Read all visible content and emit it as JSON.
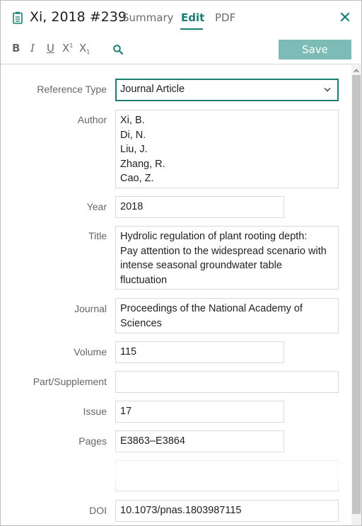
{
  "header": {
    "title": "Xi, 2018 #239",
    "icon": "clipboard-icon",
    "tabs": [
      {
        "label": "Summary",
        "active": false
      },
      {
        "label": "Edit",
        "active": true
      },
      {
        "label": "PDF",
        "active": false
      }
    ],
    "close_icon": "close-icon"
  },
  "toolbar": {
    "bold": "B",
    "italic": "I",
    "underline": "U",
    "superscript": "X",
    "superscript_mark": "1",
    "subscript": "X",
    "subscript_mark": "1",
    "search_icon": "search-icon",
    "save_label": "Save"
  },
  "colors": {
    "accent": "#177e74",
    "save_button": "#7dbcb6",
    "label_text": "#666666",
    "field_border": "#d9d9d9"
  },
  "form": {
    "reference_type": {
      "label": "Reference Type",
      "value": "Journal Article"
    },
    "author": {
      "label": "Author",
      "lines": [
        "Xi, B.",
        "Di, N.",
        "Liu, J.",
        "Zhang, R.",
        "Cao, Z."
      ]
    },
    "year": {
      "label": "Year",
      "value": "2018"
    },
    "title": {
      "label": "Title",
      "lines": [
        "Hydrolic regulation of plant rooting depth:",
        "Pay attention to the widespread scenario with",
        "intense seasonal groundwater table",
        "fluctuation"
      ]
    },
    "journal": {
      "label": "Journal",
      "lines": [
        "Proceedings of the National Academy of",
        "Sciences"
      ]
    },
    "volume": {
      "label": "Volume",
      "value": "115"
    },
    "part_supplement": {
      "label": "Part/Supplement",
      "value": ""
    },
    "issue": {
      "label": "Issue",
      "value": "17"
    },
    "pages": {
      "label": "Pages",
      "value": "E3863–E3864"
    },
    "doi": {
      "label": "DOI",
      "value": "10.1073/pnas.1803987115"
    }
  }
}
